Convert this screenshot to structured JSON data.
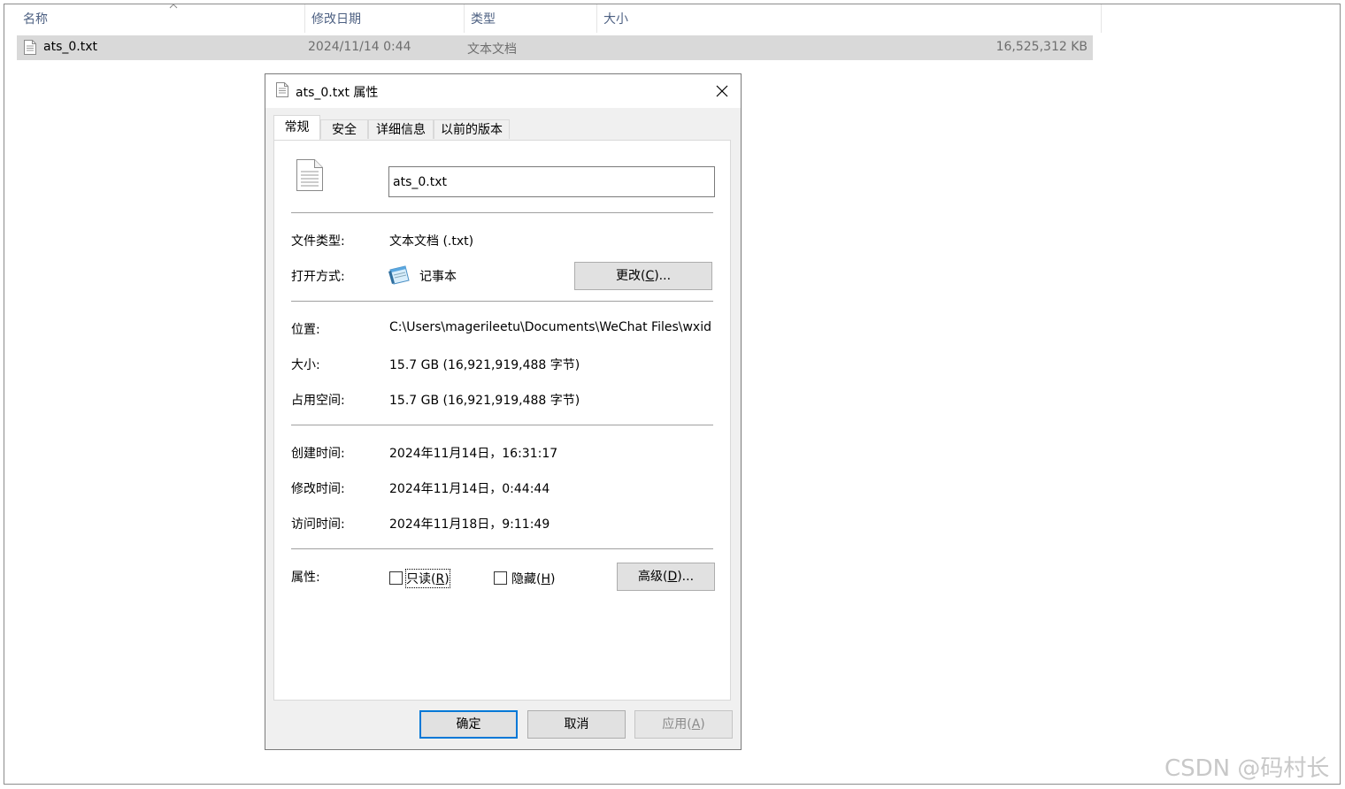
{
  "explorer": {
    "columns": {
      "name": "名称",
      "modified": "修改日期",
      "type": "类型",
      "size": "大小"
    },
    "file": {
      "name": "ats_0.txt",
      "modified": "2024/11/14 0:44",
      "type": "文本文档",
      "size": "16,525,312 KB"
    }
  },
  "dialog": {
    "title": "ats_0.txt 属性",
    "tabs": [
      {
        "label": "常规",
        "active": true
      },
      {
        "label": "安全",
        "active": false
      },
      {
        "label": "详细信息",
        "active": false
      },
      {
        "label": "以前的版本",
        "active": false
      }
    ],
    "general": {
      "filename_value": "ats_0.txt",
      "file_type_label": "文件类型:",
      "file_type_value": "文本文档 (.txt)",
      "open_with_label": "打开方式:",
      "open_with_value": "记事本",
      "change_button": {
        "prefix": "更改(",
        "key": "C",
        "suffix": ")..."
      },
      "location_label": "位置:",
      "location_value": "C:\\Users\\magerileetu\\Documents\\WeChat Files\\wxid",
      "size_label": "大小:",
      "size_value": "15.7 GB (16,921,919,488 字节)",
      "disk_size_label": "占用空间:",
      "disk_size_value": "15.7 GB (16,921,919,488 字节)",
      "created_label": "创建时间:",
      "created_value": "2024年11月14日，16:31:17",
      "modified_label": "修改时间:",
      "modified_value": "2024年11月14日，0:44:44",
      "accessed_label": "访问时间:",
      "accessed_value": "2024年11月18日，9:11:49",
      "attributes_label": "属性:",
      "readonly": {
        "prefix": "只读(",
        "key": "R",
        "suffix": ")",
        "checked": false
      },
      "hidden": {
        "prefix": "隐藏(",
        "key": "H",
        "suffix": ")",
        "checked": false
      },
      "advanced_button": {
        "prefix": "高级(",
        "key": "D",
        "suffix": ")..."
      }
    },
    "footer": {
      "ok": "确定",
      "cancel": "取消",
      "apply": {
        "prefix": "应用(",
        "key": "A",
        "suffix": ")"
      }
    }
  },
  "watermark": "CSDN @码村长",
  "colors": {
    "accent": "#0078d7",
    "selection": "#d9d9d9",
    "header_text": "#4d6082"
  },
  "icons": [
    "text-file-icon",
    "notepad-icon",
    "close-icon",
    "sort-up-icon"
  ]
}
